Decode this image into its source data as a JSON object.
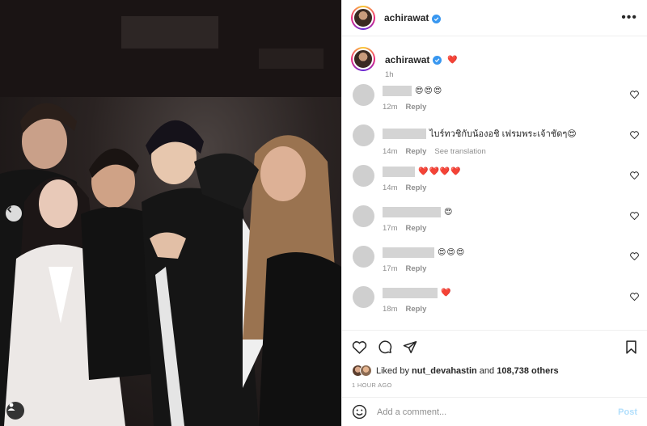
{
  "post": {
    "username": "achirawat",
    "verified": true
  },
  "caption": {
    "username": "achirawat",
    "text": "❤️",
    "time": "1h"
  },
  "comments": [
    {
      "text": "😍😍😍",
      "time": "12m",
      "reply": "Reply",
      "translate": ""
    },
    {
      "text": "ไบร์ทวชิกับน้องอชิ เฟรมพระเจ้าชัดๆ😍",
      "time": "14m",
      "reply": "Reply",
      "translate": "See translation"
    },
    {
      "text": "❤️❤️❤️❤️",
      "time": "14m",
      "reply": "Reply",
      "translate": ""
    },
    {
      "text": "😍",
      "time": "17m",
      "reply": "Reply",
      "translate": ""
    },
    {
      "text": "😍😍😍",
      "time": "17m",
      "reply": "Reply",
      "translate": ""
    },
    {
      "text": "❤️",
      "time": "18m",
      "reply": "Reply",
      "translate": ""
    }
  ],
  "likes": {
    "prefix": "Liked by",
    "user": "nut_devahastin",
    "and": "and",
    "others": "108,738 others"
  },
  "timestamp": "1 HOUR AGO",
  "add_comment": {
    "placeholder": "Add a comment...",
    "post_label": "Post"
  },
  "icons": {
    "more": "more-options-icon",
    "like": "heart-icon",
    "comment": "comment-icon",
    "share": "share-icon",
    "save": "bookmark-icon",
    "emoji": "emoji-icon",
    "prev": "chevron-left-icon",
    "tag": "user-tag-icon"
  },
  "colors": {
    "verified": "#3897f0",
    "secondary_text": "#8e8e8e",
    "post_button_disabled": "#b2dffc"
  }
}
